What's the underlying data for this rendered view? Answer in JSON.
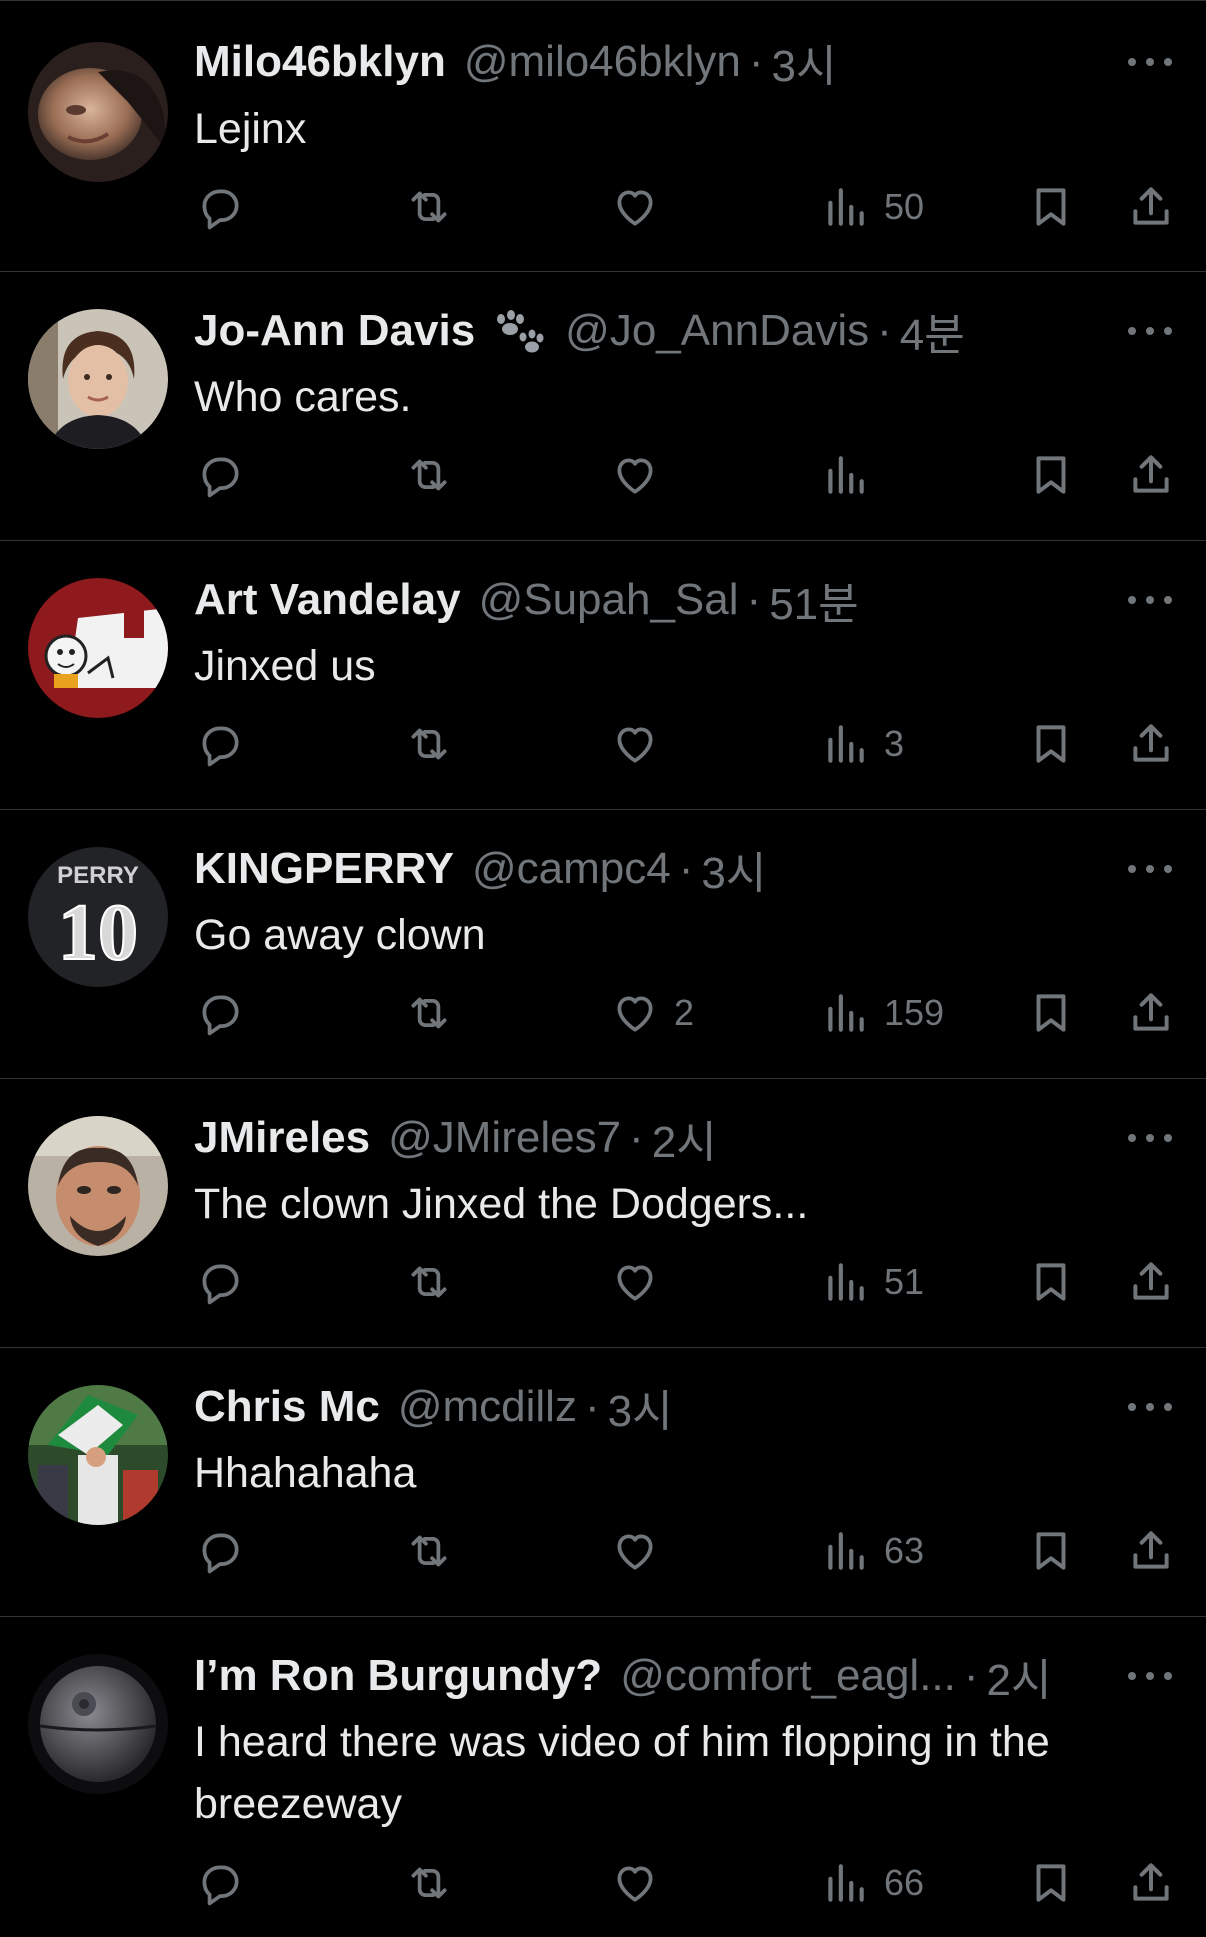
{
  "colors": {
    "background": "#000000",
    "text": "#e7e9ea",
    "muted": "#71767b",
    "divider": "#2f3336"
  },
  "icons": {
    "reply": "reply-icon",
    "retweet": "retweet-icon",
    "like": "heart-icon",
    "views": "views-chart-icon",
    "bookmark": "bookmark-icon",
    "share": "share-icon",
    "more": "more-options-icon",
    "badge": "paw-prints-icon"
  },
  "tweets": [
    {
      "name": "Milo46bklyn",
      "handle": "@milo46bklyn",
      "separator": "·",
      "time": "3시",
      "text": "Lejinx",
      "likes": "",
      "views": "50",
      "badge": false
    },
    {
      "name": "Jo-Ann Davis",
      "handle": "@Jo_AnnDavis",
      "separator": "·",
      "time": "4분",
      "text": "Who cares.",
      "likes": "",
      "views": "",
      "badge": true
    },
    {
      "name": "Art Vandelay",
      "handle": "@Supah_Sal",
      "separator": "·",
      "time": "51분",
      "text": "Jinxed us",
      "likes": "",
      "views": "3",
      "badge": false
    },
    {
      "name": "KINGPERRY",
      "handle": "@campc4",
      "separator": "·",
      "time": "3시",
      "text": "Go away clown",
      "likes": "2",
      "views": "159",
      "badge": false,
      "avatar_text": {
        "top": "PERRY",
        "number": "10"
      }
    },
    {
      "name": "JMireles",
      "handle": "@JMireles7",
      "separator": "·",
      "time": "2시",
      "text": "The clown Jinxed the Dodgers...",
      "likes": "",
      "views": "51",
      "badge": false
    },
    {
      "name": "Chris Mc",
      "handle": "@mcdillz",
      "separator": "·",
      "time": "3시",
      "text": "Hhahahaha",
      "likes": "",
      "views": "63",
      "badge": false
    },
    {
      "name": "I’m Ron Burgundy?",
      "handle": "@comfort_eagl...",
      "separator": "·",
      "time": "2시",
      "text": "I heard there was video of him flopping in the breezeway",
      "likes": "",
      "views": "66",
      "badge": false
    }
  ]
}
